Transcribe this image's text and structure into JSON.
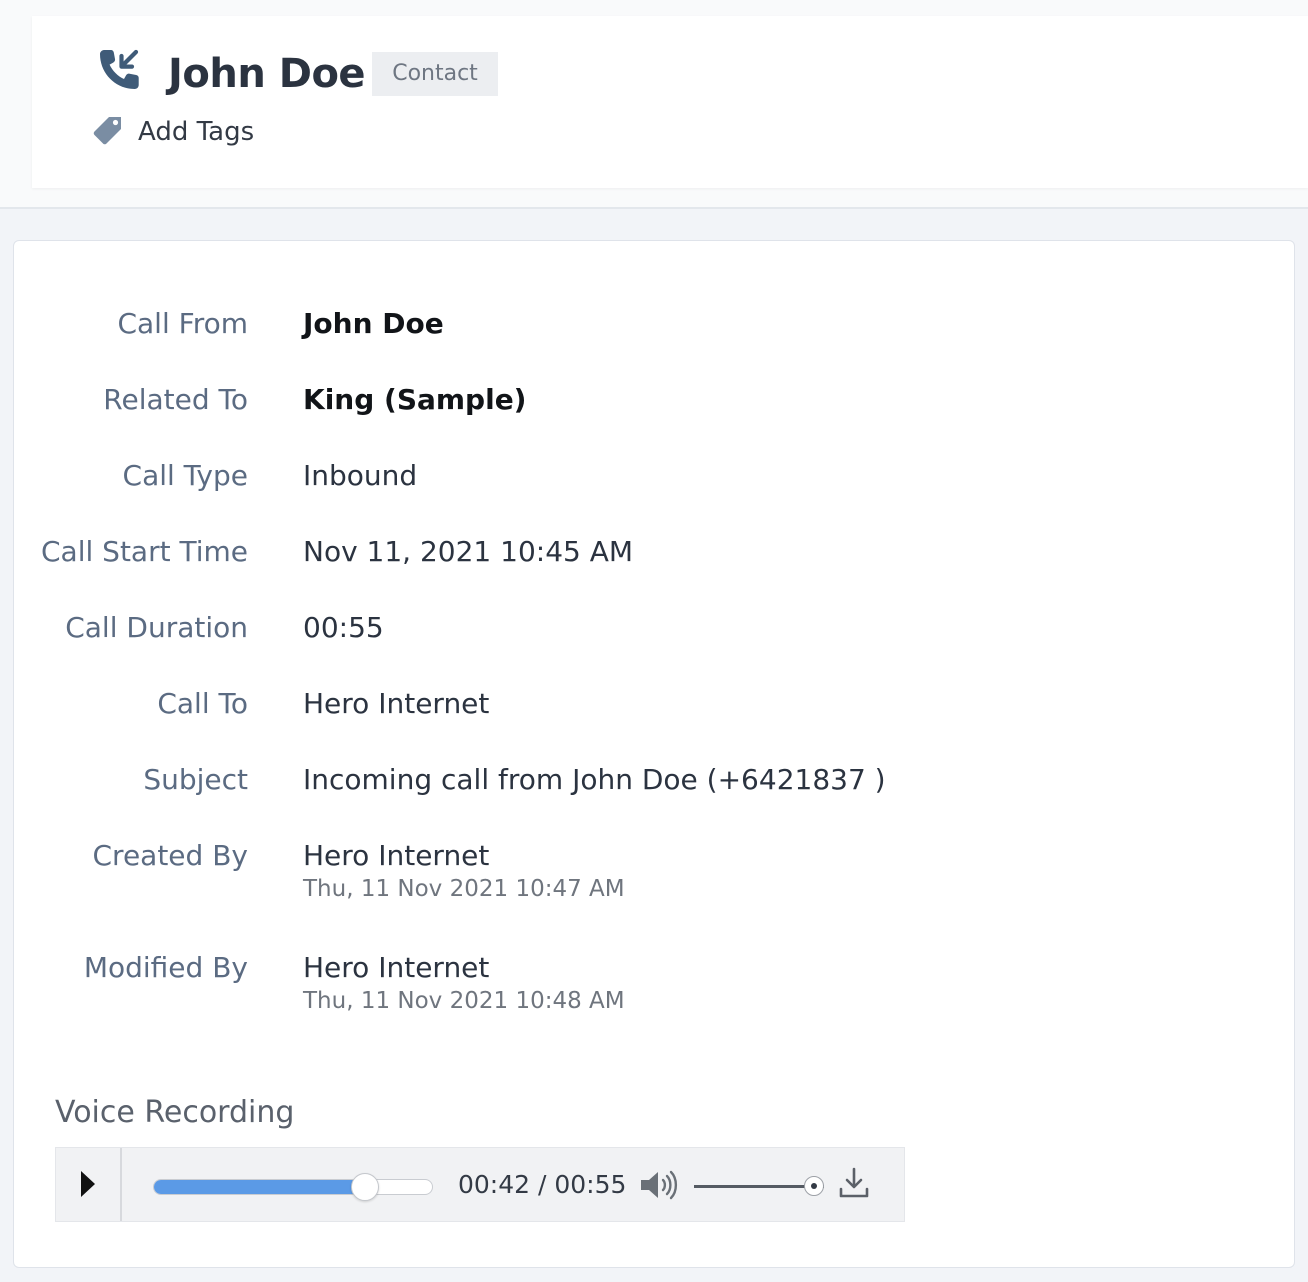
{
  "header": {
    "icon": "incoming-call-icon",
    "title": "John Doe",
    "badge": "Contact",
    "add_tags_icon": "tag-icon",
    "add_tags_label": "Add Tags"
  },
  "details": [
    {
      "label": "Call From",
      "value": "John Doe",
      "bold": true
    },
    {
      "label": "Related To",
      "value": "King (Sample)",
      "bold": true
    },
    {
      "label": "Call Type",
      "value": "Inbound"
    },
    {
      "label": "Call Start Time",
      "value": "Nov 11, 2021 10:45 AM"
    },
    {
      "label": "Call Duration",
      "value": "00:55"
    },
    {
      "label": "Call To",
      "value": "Hero Internet"
    },
    {
      "label": "Subject",
      "value": "Incoming call from John Doe (+6421837     )"
    },
    {
      "label": "Created By",
      "value": "Hero Internet",
      "sub": "Thu, 11 Nov 2021 10:47 AM"
    },
    {
      "label": "Modified By",
      "value": "Hero Internet",
      "sub": "Thu, 11 Nov 2021 10:48 AM"
    }
  ],
  "recording": {
    "label": "Voice Recording",
    "current_time": "00:42",
    "separator": " / ",
    "total_time": "00:55",
    "progress_fraction": 0.76,
    "volume_fraction": 0.92,
    "icons": {
      "play": "play-icon",
      "volume": "volume-icon",
      "download": "download-icon"
    }
  },
  "colors": {
    "label": "#5b6b82",
    "value": "#2b3340",
    "progress": "#5b9ae6",
    "badge_bg": "#eceef1"
  }
}
